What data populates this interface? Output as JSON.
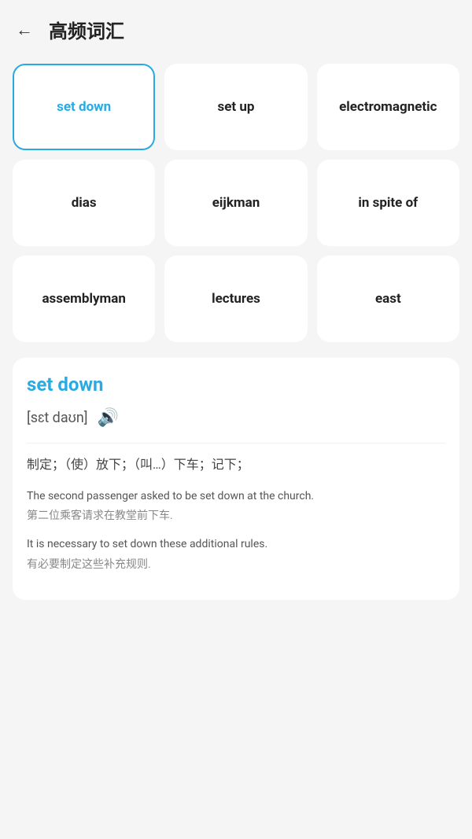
{
  "header": {
    "back_label": "←",
    "title": "高频词汇"
  },
  "words": [
    {
      "id": "set-down",
      "label": "set down",
      "active": true
    },
    {
      "id": "set-up",
      "label": "set up",
      "active": false
    },
    {
      "id": "electromagnetic",
      "label": "electromagnetic",
      "active": false
    },
    {
      "id": "dias",
      "label": "dias",
      "active": false
    },
    {
      "id": "eijkman",
      "label": "eijkman",
      "active": false
    },
    {
      "id": "in-spite-of",
      "label": "in spite of",
      "active": false
    },
    {
      "id": "assemblyman",
      "label": "assemblyman",
      "active": false
    },
    {
      "id": "lectures",
      "label": "lectures",
      "active": false
    },
    {
      "id": "east",
      "label": "east",
      "active": false
    }
  ],
  "detail": {
    "word": "set down",
    "phonetic": "[sɛt daʊn]",
    "definition": "制定；（使）放下；（叫…）下车；记下；",
    "examples": [
      {
        "en": "The second passenger asked to be set down at the church.",
        "zh": "第二位乘客请求在教堂前下车."
      },
      {
        "en": "It is necessary to set down these additional rules.",
        "zh": "有必要制定这些补充规则."
      }
    ]
  },
  "icons": {
    "back": "←",
    "sound": "🔊"
  }
}
